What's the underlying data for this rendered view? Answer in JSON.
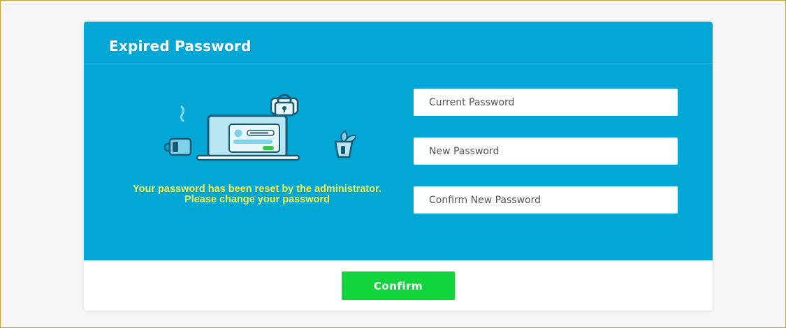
{
  "dialog": {
    "title": "Expired Password",
    "message": "Your password has been reset by the administrator. Please change your password",
    "fields": {
      "current_password": {
        "placeholder": "Current Password",
        "value": ""
      },
      "new_password": {
        "placeholder": "New Password",
        "value": ""
      },
      "confirm_new_password": {
        "placeholder": "Confirm New Password",
        "value": ""
      }
    },
    "confirm_label": "Confirm"
  },
  "colors": {
    "panel_background": "#03a7d6",
    "message_text": "#f3f34a",
    "confirm_button": "#12d43c",
    "page_border": "#c9a23a"
  },
  "icons": [
    "laptop-lock-illustration",
    "padlock-icon",
    "coffee-mug-icon",
    "plant-pot-icon"
  ]
}
